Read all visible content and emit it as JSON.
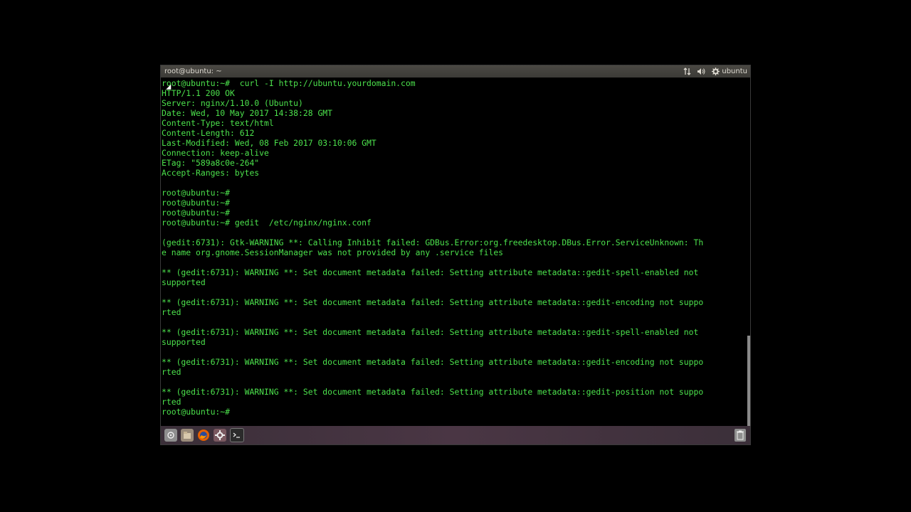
{
  "topbar": {
    "window_title": "root@ubuntu: ~",
    "user": "ubuntu"
  },
  "terminal": {
    "lines": [
      "root@ubuntu:~#  curl -I http://ubuntu.yourdomain.com",
      "HTTP/1.1 200 OK",
      "Server: nginx/1.10.0 (Ubuntu)",
      "Date: Wed, 10 May 2017 14:38:28 GMT",
      "Content-Type: text/html",
      "Content-Length: 612",
      "Last-Modified: Wed, 08 Feb 2017 03:10:06 GMT",
      "Connection: keep-alive",
      "ETag: \"589a8c0e-264\"",
      "Accept-Ranges: bytes",
      "",
      "root@ubuntu:~#",
      "root@ubuntu:~#",
      "root@ubuntu:~#",
      "root@ubuntu:~# gedit  /etc/nginx/nginx.conf",
      "",
      "(gedit:6731): Gtk-WARNING **: Calling Inhibit failed: GDBus.Error:org.freedesktop.DBus.Error.ServiceUnknown: Th",
      "e name org.gnome.SessionManager was not provided by any .service files",
      "",
      "** (gedit:6731): WARNING **: Set document metadata failed: Setting attribute metadata::gedit-spell-enabled not",
      "supported",
      "",
      "** (gedit:6731): WARNING **: Set document metadata failed: Setting attribute metadata::gedit-encoding not suppo",
      "rted",
      "",
      "** (gedit:6731): WARNING **: Set document metadata failed: Setting attribute metadata::gedit-spell-enabled not",
      "supported",
      "",
      "** (gedit:6731): WARNING **: Set document metadata failed: Setting attribute metadata::gedit-encoding not suppo",
      "rted",
      "",
      "** (gedit:6731): WARNING **: Set document metadata failed: Setting attribute metadata::gedit-position not suppo",
      "rted",
      "root@ubuntu:~#"
    ]
  },
  "launcher": {
    "items": [
      "show-desktop",
      "files",
      "firefox",
      "system-settings",
      "terminal"
    ]
  }
}
